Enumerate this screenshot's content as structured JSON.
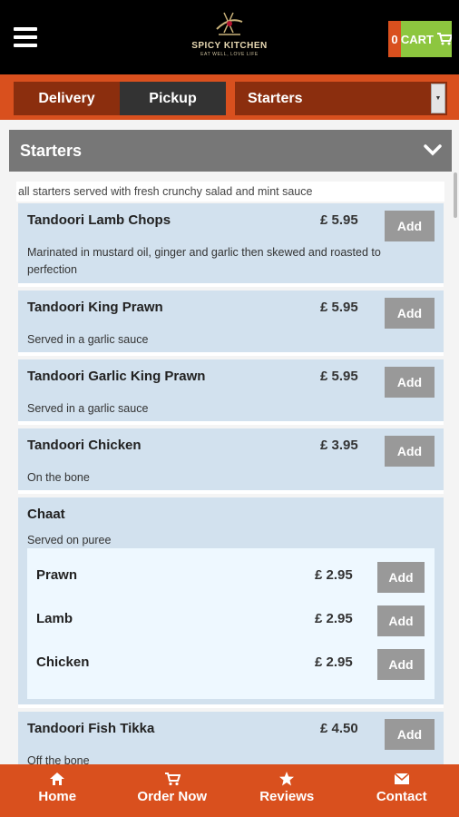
{
  "header": {
    "brand": "SPICY KITCHEN",
    "tagline": "EAT WELL, LOVE LIFE",
    "cart_count": "0",
    "cart_label": "CART"
  },
  "order_bar": {
    "delivery_label": "Delivery",
    "pickup_label": "Pickup",
    "category_selected": "Starters"
  },
  "category": {
    "title": "Starters",
    "description": "all starters served with fresh crunchy salad and mint sauce"
  },
  "items": [
    {
      "name": "Tandoori Lamb Chops",
      "price": "£ 5.95",
      "add": "Add",
      "desc": "Marinated in mustard oil, ginger and garlic then skewed and roasted to perfection"
    },
    {
      "name": "Tandoori King Prawn",
      "price": "£ 5.95",
      "add": "Add",
      "desc": "Served in a garlic sauce"
    },
    {
      "name": "Tandoori Garlic King Prawn",
      "price": "£ 5.95",
      "add": "Add",
      "desc": "Served in a garlic sauce"
    },
    {
      "name": "Tandoori Chicken",
      "price": "£ 3.95",
      "add": "Add",
      "desc": "On the bone"
    },
    {
      "name": "Chaat",
      "desc": "Served on puree",
      "options": [
        {
          "name": "Prawn",
          "price": "£ 2.95",
          "add": "Add"
        },
        {
          "name": "Lamb",
          "price": "£ 2.95",
          "add": "Add"
        },
        {
          "name": "Chicken",
          "price": "£ 2.95",
          "add": "Add"
        }
      ]
    },
    {
      "name": "Tandoori Fish Tikka",
      "price": "£ 4.50",
      "add": "Add",
      "desc": "Off the bone"
    }
  ],
  "footer": {
    "home": "Home",
    "order_now": "Order Now",
    "reviews": "Reviews",
    "contact": "Contact"
  },
  "colors": {
    "accent": "#d9501e",
    "dark_accent": "#8b2e0e",
    "cart_green": "#8dc63f",
    "item_bg": "#d2e1ee"
  }
}
